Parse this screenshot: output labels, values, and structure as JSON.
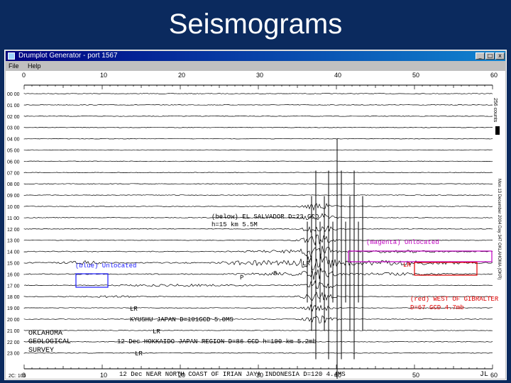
{
  "slide_title": "Seismograms",
  "window": {
    "title": "Drumplot Generator - port 1567",
    "menu": [
      "File",
      "Help"
    ],
    "buttons": {
      "minimize": "_",
      "maximize": "□",
      "close": "x"
    }
  },
  "plot": {
    "x_ticks": [
      "0",
      "10",
      "20",
      "30",
      "40",
      "50",
      "60"
    ],
    "hour_labels": [
      "00 00",
      "01 00",
      "02 00",
      "03 00",
      "04 00",
      "05 00",
      "06 00",
      "07 00",
      "08 00",
      "09 00",
      "10 00",
      "11 00",
      "12 00",
      "13 00",
      "14 00",
      "15 00",
      "16 00",
      "17 00",
      "18 00",
      "19 00",
      "20 00",
      "21 00",
      "22 00",
      "23 00"
    ],
    "side_label_top": "256 counts",
    "side_label_right": "Mon 13 December 2004 Day 347 OKLAHOMA (OKR)",
    "annotations": {
      "salvador_line1": "(below) EL SALVADOR D=23 GCD",
      "salvador_line2": "h=15 km 5.5M",
      "magenta_label": "(magenta) Unlocated",
      "blue_label": "(blue) Unlocated",
      "red_label1": "(red) WEST OF GIBRALTER",
      "red_label2": "D=67 GCD 4.7mb",
      "lr_magenta": "LR",
      "p_phase": "P",
      "s_phase": "S",
      "lr_mid": "LR",
      "lr_kyushu": "LR",
      "kyushu": "KYUSHU JAPAN D=101GCD 5.0MS",
      "lr_hokkaido": "LR",
      "hokkaido": "12 Dec HOKKAIDO JAPAN REGION D=86 GCD h=100 km 5.2mb",
      "lr_irian": "LR",
      "irian": "12 Dec NEAR NORTH COAST OF IRIAN JAYA INDONESIA D=120 4.4MS",
      "ogs1": "OKLAHOMA",
      "ogs2": "GEOLOGICAL",
      "ogs3": "SURVEY",
      "initials": "JL"
    },
    "status": "2C: 105"
  },
  "colors": {
    "slide_bg": "#0b2a5e",
    "trace": "#000000",
    "annotation_magenta": "#c000c0",
    "annotation_blue": "#1a1aff",
    "annotation_red": "#e00000"
  }
}
